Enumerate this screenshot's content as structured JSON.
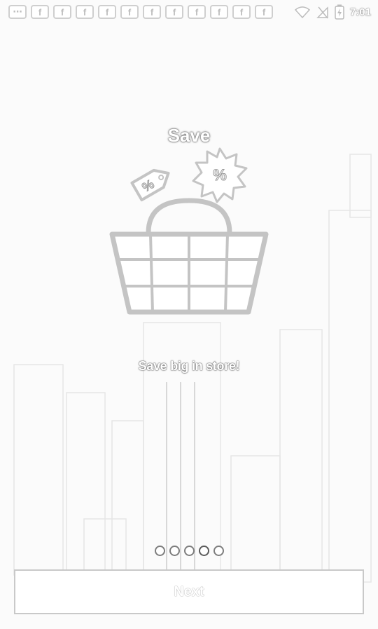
{
  "status_bar": {
    "notification_icons": [
      "more-icon",
      "facebook-icon",
      "facebook-icon",
      "facebook-icon",
      "facebook-icon",
      "facebook-icon",
      "facebook-icon",
      "facebook-icon",
      "facebook-icon",
      "facebook-icon",
      "facebook-icon",
      "facebook-icon"
    ],
    "time": "7:01"
  },
  "onboarding": {
    "title": "Save",
    "subtitle": "Save big in store!",
    "illustration": [
      "price-tag-icon",
      "discount-badge-icon",
      "shopping-basket-icon"
    ],
    "page_count": 5,
    "active_page_index": 3
  },
  "next_label": "Next"
}
